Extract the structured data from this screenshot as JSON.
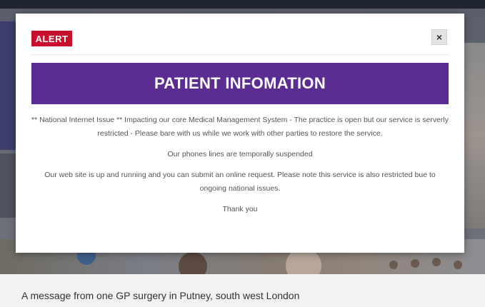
{
  "modal": {
    "badge": "ALERT",
    "close": "×",
    "banner": "PATIENT INFOMATION",
    "paragraphs": [
      "** National Internet Issue ** Impacting our core Medical Management System - The practice is open but our service is serverly restricted - Please bare with us while we work with other parties to restore the service.",
      "Our phones lines are temporally suspended",
      "Our web site is up and running and you can submit an online request. Please note this service is also restricted bue to ongoing national issues.",
      "Thank you"
    ]
  },
  "caption": "A message from one GP surgery in Putney, south west London",
  "colors": {
    "alert": "#c8102e",
    "banner": "#5b2c91",
    "overlay": "#676b76"
  },
  "icons": [
    "close-icon"
  ]
}
